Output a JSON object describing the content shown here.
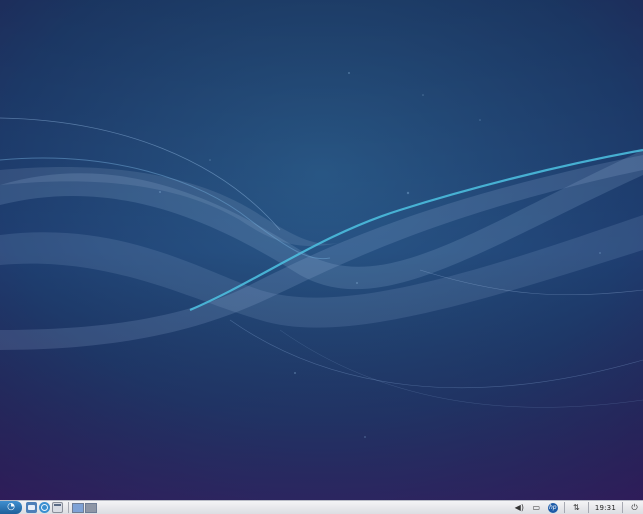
{
  "desktop": {
    "wallpaper_colors": {
      "top": "#1b3a66",
      "middle": "#24477a",
      "bottom": "#2a1f5e",
      "accent": "#3fb3d6"
    }
  },
  "taskbar": {
    "menu_icon": "lubuntu-logo-icon",
    "launchers": [
      {
        "name": "file-manager-launcher",
        "icon": "folder-icon",
        "color": "#4d7fb8"
      },
      {
        "name": "browser-launcher",
        "icon": "globe-icon",
        "color": "#3a8fd0"
      },
      {
        "name": "terminal-launcher",
        "icon": "window-icon",
        "color": "#d9dce4"
      }
    ],
    "pagers": [
      {
        "name": "desktop-1",
        "color": "#7fa2d6"
      },
      {
        "name": "desktop-2",
        "color": "#8e96a6"
      }
    ],
    "tray": {
      "volume_icon": "volume-icon",
      "network_icon": "network-icon",
      "hp_icon": "hp-icon",
      "update_icon": "update-icon",
      "clock": "19:31",
      "power_icon": "power-icon"
    }
  }
}
